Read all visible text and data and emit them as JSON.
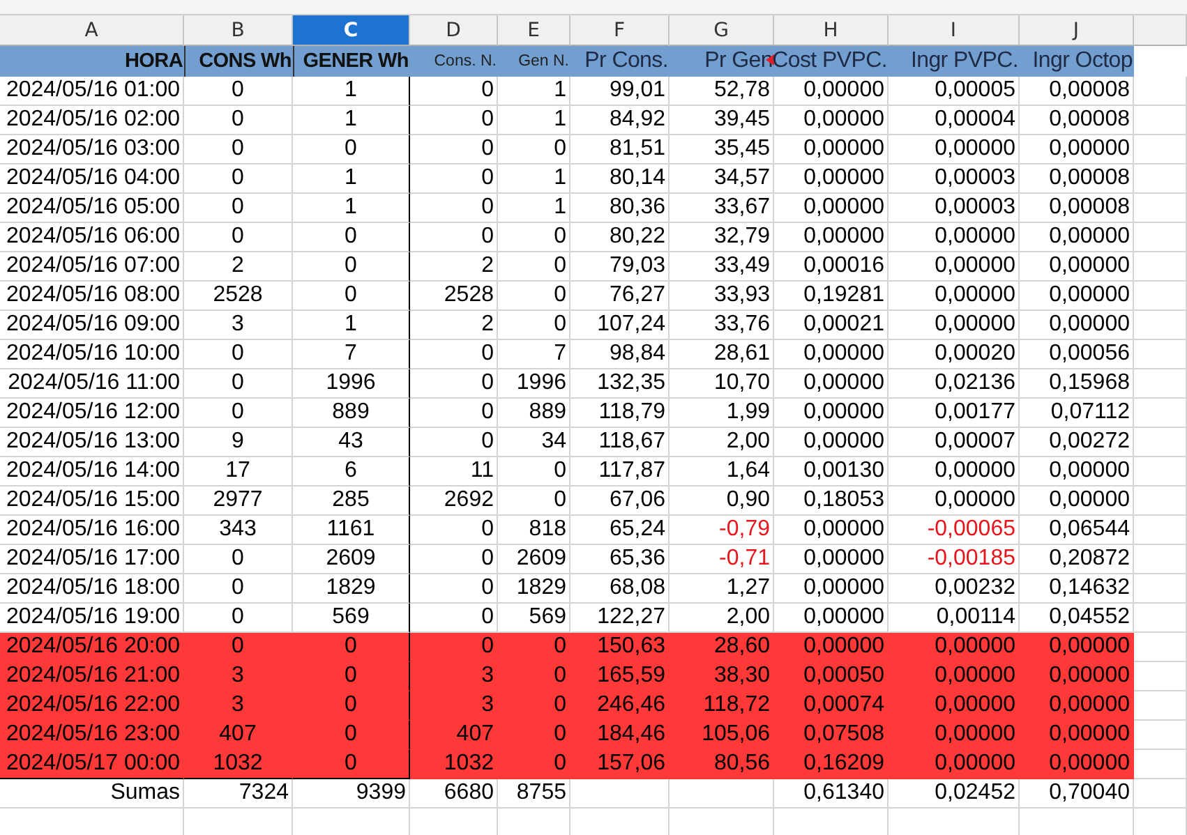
{
  "columns": [
    {
      "letter": "A",
      "selected": false
    },
    {
      "letter": "B",
      "selected": false
    },
    {
      "letter": "C",
      "selected": true
    },
    {
      "letter": "D",
      "selected": false
    },
    {
      "letter": "E",
      "selected": false
    },
    {
      "letter": "F",
      "selected": false
    },
    {
      "letter": "G",
      "selected": false
    },
    {
      "letter": "H",
      "selected": false
    },
    {
      "letter": "I",
      "selected": false
    },
    {
      "letter": "J",
      "selected": false
    }
  ],
  "headers": [
    {
      "text": "HORA",
      "comment": false
    },
    {
      "text": "CONS Wh",
      "comment": false
    },
    {
      "text": "GENER Wh",
      "comment": false
    },
    {
      "text": "Cons. N.",
      "comment": false
    },
    {
      "text": "Gen N.",
      "comment": false
    },
    {
      "text": "Pr Cons.",
      "comment": false
    },
    {
      "text": "Pr Gen",
      "comment": true
    },
    {
      "text": "Cost PVPC.",
      "comment": false
    },
    {
      "text": "Ingr PVPC.",
      "comment": false
    },
    {
      "text": "Ingr Octop",
      "comment": false
    }
  ],
  "rows": [
    {
      "kind": "data",
      "highlighted": false,
      "cells": [
        "2024/05/16 01:00",
        "0",
        "1",
        "0",
        "1",
        "99,01",
        "52,78",
        "0,00000",
        "0,00005",
        "0,00008"
      ]
    },
    {
      "kind": "data",
      "highlighted": false,
      "cells": [
        "2024/05/16 02:00",
        "0",
        "1",
        "0",
        "1",
        "84,92",
        "39,45",
        "0,00000",
        "0,00004",
        "0,00008"
      ]
    },
    {
      "kind": "data",
      "highlighted": false,
      "cells": [
        "2024/05/16 03:00",
        "0",
        "0",
        "0",
        "0",
        "81,51",
        "35,45",
        "0,00000",
        "0,00000",
        "0,00000"
      ]
    },
    {
      "kind": "data",
      "highlighted": false,
      "cells": [
        "2024/05/16 04:00",
        "0",
        "1",
        "0",
        "1",
        "80,14",
        "34,57",
        "0,00000",
        "0,00003",
        "0,00008"
      ]
    },
    {
      "kind": "data",
      "highlighted": false,
      "cells": [
        "2024/05/16 05:00",
        "0",
        "1",
        "0",
        "1",
        "80,36",
        "33,67",
        "0,00000",
        "0,00003",
        "0,00008"
      ]
    },
    {
      "kind": "data",
      "highlighted": false,
      "cells": [
        "2024/05/16 06:00",
        "0",
        "0",
        "0",
        "0",
        "80,22",
        "32,79",
        "0,00000",
        "0,00000",
        "0,00000"
      ]
    },
    {
      "kind": "data",
      "highlighted": false,
      "cells": [
        "2024/05/16 07:00",
        "2",
        "0",
        "2",
        "0",
        "79,03",
        "33,49",
        "0,00016",
        "0,00000",
        "0,00000"
      ]
    },
    {
      "kind": "data",
      "highlighted": false,
      "cells": [
        "2024/05/16 08:00",
        "2528",
        "0",
        "2528",
        "0",
        "76,27",
        "33,93",
        "0,19281",
        "0,00000",
        "0,00000"
      ]
    },
    {
      "kind": "data",
      "highlighted": false,
      "cells": [
        "2024/05/16 09:00",
        "3",
        "1",
        "2",
        "0",
        "107,24",
        "33,76",
        "0,00021",
        "0,00000",
        "0,00000"
      ]
    },
    {
      "kind": "data",
      "highlighted": false,
      "cells": [
        "2024/05/16 10:00",
        "0",
        "7",
        "0",
        "7",
        "98,84",
        "28,61",
        "0,00000",
        "0,00020",
        "0,00056"
      ]
    },
    {
      "kind": "data",
      "highlighted": false,
      "cells": [
        "2024/05/16 11:00",
        "0",
        "1996",
        "0",
        "1996",
        "132,35",
        "10,70",
        "0,00000",
        "0,02136",
        "0,15968"
      ]
    },
    {
      "kind": "data",
      "highlighted": false,
      "cells": [
        "2024/05/16 12:00",
        "0",
        "889",
        "0",
        "889",
        "118,79",
        "1,99",
        "0,00000",
        "0,00177",
        "0,07112"
      ]
    },
    {
      "kind": "data",
      "highlighted": false,
      "cells": [
        "2024/05/16 13:00",
        "9",
        "43",
        "0",
        "34",
        "118,67",
        "2,00",
        "0,00000",
        "0,00007",
        "0,00272"
      ]
    },
    {
      "kind": "data",
      "highlighted": false,
      "cells": [
        "2024/05/16 14:00",
        "17",
        "6",
        "11",
        "0",
        "117,87",
        "1,64",
        "0,00130",
        "0,00000",
        "0,00000"
      ]
    },
    {
      "kind": "data",
      "highlighted": false,
      "cells": [
        "2024/05/16 15:00",
        "2977",
        "285",
        "2692",
        "0",
        "67,06",
        "0,90",
        "0,18053",
        "0,00000",
        "0,00000"
      ]
    },
    {
      "kind": "data",
      "highlighted": false,
      "red_text": true,
      "cells": [
        "2024/05/16 16:00",
        "343",
        "1161",
        "0",
        "818",
        "65,24",
        "-0,79",
        "0,00000",
        "-0,00065",
        "0,06544"
      ]
    },
    {
      "kind": "data",
      "highlighted": false,
      "red_text": true,
      "cells": [
        "2024/05/16 17:00",
        "0",
        "2609",
        "0",
        "2609",
        "65,36",
        "-0,71",
        "0,00000",
        "-0,00185",
        "0,20872"
      ]
    },
    {
      "kind": "data",
      "highlighted": false,
      "cells": [
        "2024/05/16 18:00",
        "0",
        "1829",
        "0",
        "1829",
        "68,08",
        "1,27",
        "0,00000",
        "0,00232",
        "0,14632"
      ]
    },
    {
      "kind": "data",
      "highlighted": false,
      "cells": [
        "2024/05/16 19:00",
        "0",
        "569",
        "0",
        "569",
        "122,27",
        "2,00",
        "0,00000",
        "0,00114",
        "0,04552"
      ]
    },
    {
      "kind": "data",
      "highlighted": true,
      "cells": [
        "2024/05/16 20:00",
        "0",
        "0",
        "0",
        "0",
        "150,63",
        "28,60",
        "0,00000",
        "0,00000",
        "0,00000"
      ]
    },
    {
      "kind": "data",
      "highlighted": true,
      "cells": [
        "2024/05/16 21:00",
        "3",
        "0",
        "3",
        "0",
        "165,59",
        "38,30",
        "0,00050",
        "0,00000",
        "0,00000"
      ]
    },
    {
      "kind": "data",
      "highlighted": true,
      "cells": [
        "2024/05/16 22:00",
        "3",
        "0",
        "3",
        "0",
        "246,46",
        "118,72",
        "0,00074",
        "0,00000",
        "0,00000"
      ]
    },
    {
      "kind": "data",
      "highlighted": true,
      "cells": [
        "2024/05/16 23:00",
        "407",
        "0",
        "407",
        "0",
        "184,46",
        "105,06",
        "0,07508",
        "0,00000",
        "0,00000"
      ]
    },
    {
      "kind": "data",
      "highlighted": true,
      "cells": [
        "2024/05/17 00:00",
        "1032",
        "0",
        "1032",
        "0",
        "157,06",
        "80,56",
        "0,16209",
        "0,00000",
        "0,00000"
      ]
    },
    {
      "kind": "total",
      "highlighted": false,
      "cells": [
        "Sumas",
        "7324",
        "9399",
        "6680",
        "8755",
        null,
        null,
        "0,61340",
        "0,02452",
        "0,70040"
      ]
    }
  ]
}
